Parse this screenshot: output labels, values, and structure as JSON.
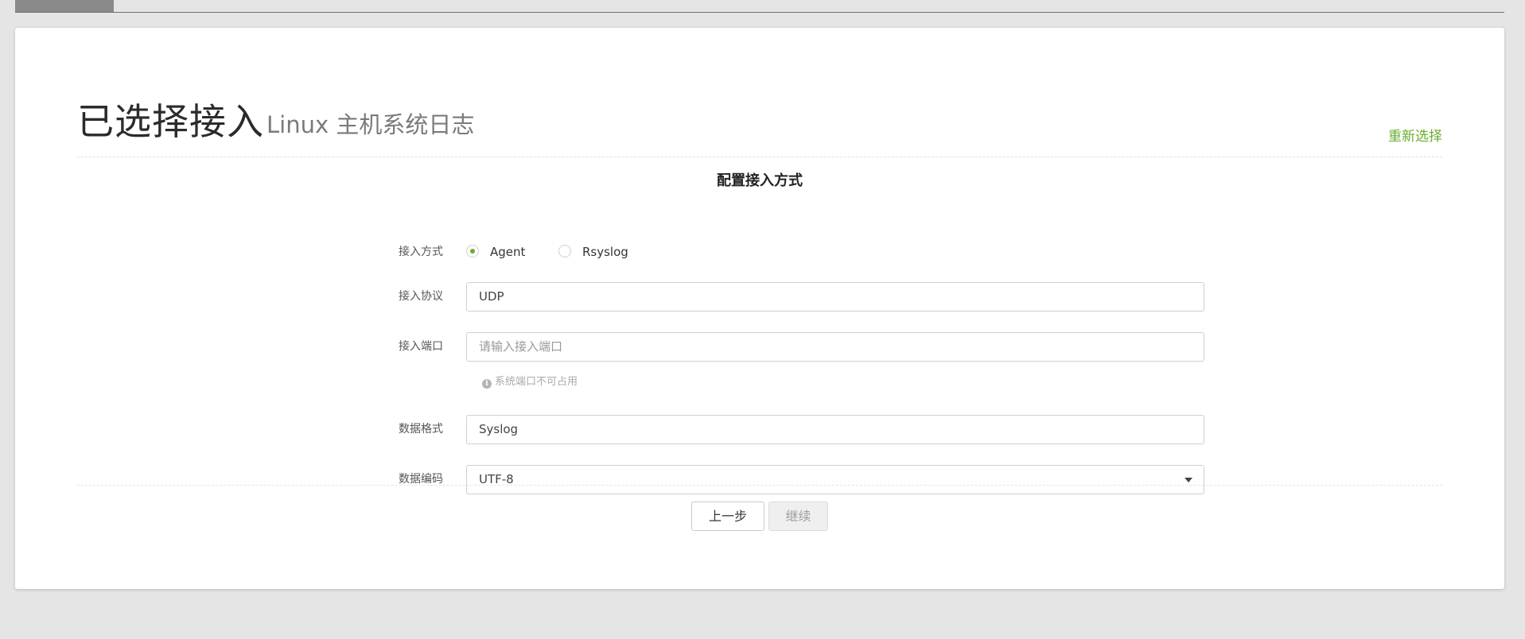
{
  "header": {
    "title": "已选择接入",
    "subtitle": "Linux 主机系统日志",
    "reselect_label": "重新选择"
  },
  "form": {
    "section_title": "配置接入方式",
    "access_method": {
      "label": "接入方式",
      "options": [
        {
          "label": "Agent",
          "checked": true
        },
        {
          "label": "Rsyslog",
          "checked": false
        }
      ]
    },
    "protocol": {
      "label": "接入协议",
      "value": "UDP"
    },
    "port": {
      "label": "接入端口",
      "placeholder": "请输入接入端口",
      "hint": "系统端口不可占用"
    },
    "data_format": {
      "label": "数据格式",
      "value": "Syslog"
    },
    "encoding": {
      "label": "数据编码",
      "value": "UTF-8"
    }
  },
  "footer": {
    "prev_label": "上一步",
    "next_label": "继续"
  },
  "colors": {
    "accent": "#6aad2f",
    "background": "#e5e5e5"
  },
  "icons": {
    "hint_icon": "info-icon",
    "select_icon": "caret-down-icon"
  }
}
